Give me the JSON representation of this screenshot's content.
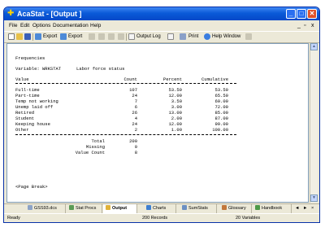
{
  "window": {
    "title": "AcaStat - [Output ]"
  },
  "menu": [
    "File",
    "Edit",
    "Options",
    "Documentation",
    "Help"
  ],
  "toolbar": {
    "export1": "Export",
    "export2": "Export",
    "output_log": "Output Log",
    "print": "Print",
    "help_window": "Help Window"
  },
  "output": {
    "heading": "Frequencies",
    "variable_label": "Variable: WRKSTAT",
    "variable_desc": "Labor force status",
    "columns": [
      "Value",
      "Count",
      "Percent",
      "Cumulative"
    ],
    "rows": [
      {
        "value": "Full-time",
        "count": "107",
        "percent": "53.50",
        "cumulative": "53.50"
      },
      {
        "value": "Part-time",
        "count": "24",
        "percent": "12.00",
        "cumulative": "65.50"
      },
      {
        "value": "Temp not working",
        "count": "7",
        "percent": "3.50",
        "cumulative": "69.00"
      },
      {
        "value": "Unemp laid off",
        "count": "6",
        "percent": "3.00",
        "cumulative": "72.00"
      },
      {
        "value": "Retired",
        "count": "26",
        "percent": "13.00",
        "cumulative": "85.00"
      },
      {
        "value": "Student",
        "count": "4",
        "percent": "2.00",
        "cumulative": "87.00"
      },
      {
        "value": "Keeping house",
        "count": "24",
        "percent": "12.00",
        "cumulative": "99.00"
      },
      {
        "value": "Other",
        "count": "2",
        "percent": "1.00",
        "cumulative": "100.00"
      }
    ],
    "summary": [
      {
        "label": "Total",
        "value": "200"
      },
      {
        "label": "Missing",
        "value": "0"
      },
      {
        "label": "Value Count",
        "value": "8"
      }
    ],
    "page_break": "<Page Break>"
  },
  "tabs": [
    "GSS93.dcs",
    "Stat Procs",
    "Output",
    "Charts",
    "SumStats",
    "Glossary",
    "Handbook"
  ],
  "status": {
    "left": "Ready",
    "records": "200 Records",
    "variables": "20 Variables"
  }
}
